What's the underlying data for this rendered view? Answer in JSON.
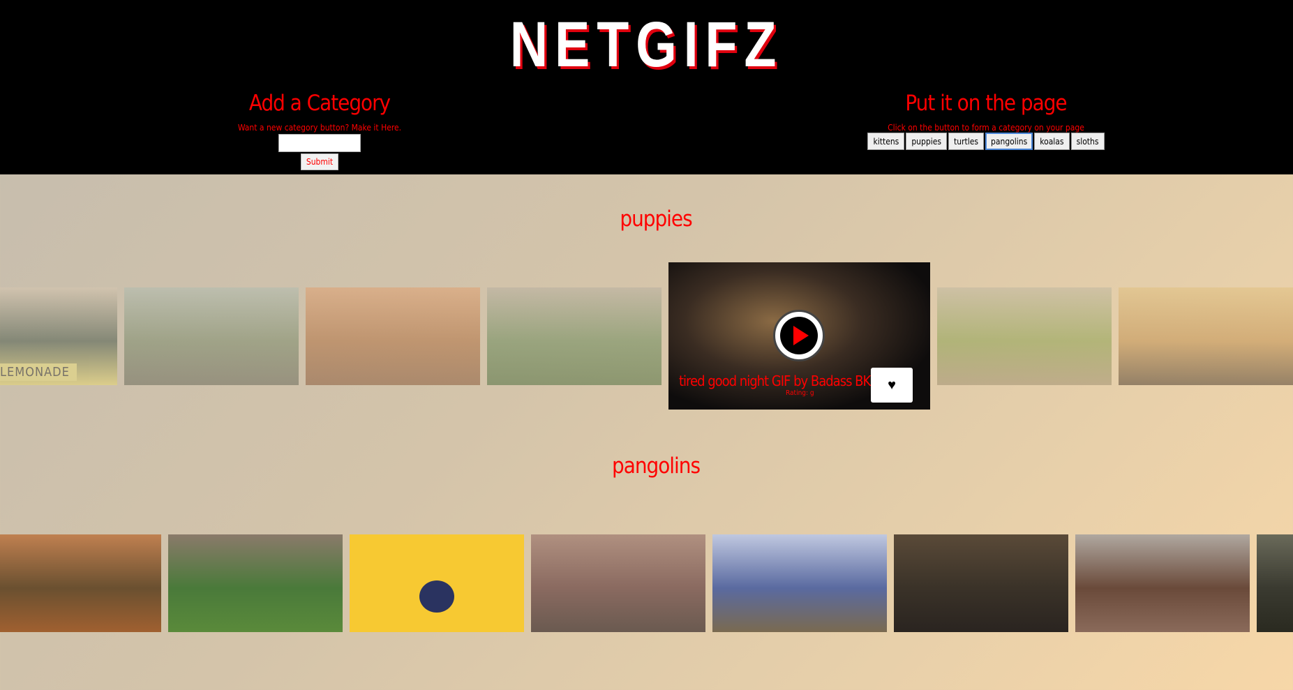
{
  "app": {
    "title": "NETGIFZ"
  },
  "add_category": {
    "heading": "Add a Category",
    "hint": "Want a new category button? Make it Here.",
    "input_value": "",
    "submit_label": "Submit"
  },
  "put_on_page": {
    "heading": "Put it on the page",
    "hint": "Click on the button to form a category on your page",
    "buttons": [
      "kittens",
      "puppies",
      "turtles",
      "pangolins",
      "koalas",
      "sloths"
    ],
    "focused_button": "pangolins"
  },
  "sections": [
    {
      "title": "puppies",
      "featured": {
        "title": "tired good night GIF by Badass BK",
        "rating": "Rating: g",
        "play_icon": "play-icon",
        "favorite_icon": "heart-icon"
      },
      "thumbs": [
        {
          "label": "LEMONADE",
          "colors": [
            "#4a5a4a",
            "#d6c6b0",
            "#e8d870"
          ]
        },
        {
          "colors": [
            "#7a8a6a",
            "#b0bcb0",
            "#6a6a5a"
          ]
        },
        {
          "colors": [
            "#b07040",
            "#e0a070",
            "#8a5a3a"
          ]
        },
        {
          "colors": [
            "#6a8a5a",
            "#b8b0a0",
            "#507040"
          ]
        },
        {
          "colors": [
            "#8aa050",
            "#c0b8a0",
            "#a09070"
          ]
        },
        {
          "colors": [
            "#c09050",
            "#e0c080",
            "#504030"
          ]
        }
      ]
    },
    {
      "title": "pangolins",
      "thumbs": [
        {
          "colors": [
            "#6a5030",
            "#c08050",
            "#a06030"
          ]
        },
        {
          "colors": [
            "#4a7a3a",
            "#8a7a6a",
            "#5a8a3a"
          ]
        },
        {
          "colors": [
            "#f7c932",
            "#f7c932",
            "#2a3360"
          ]
        },
        {
          "colors": [
            "#8a6a60",
            "#b09080",
            "#6a5a50"
          ]
        },
        {
          "colors": [
            "#5a6aa0",
            "#c0c8e0",
            "#7a6a50"
          ]
        },
        {
          "colors": [
            "#3a3228",
            "#5a4a38",
            "#2a2420"
          ]
        },
        {
          "colors": [
            "#6a4a3a",
            "#b0a8a0",
            "#8a6a5a"
          ]
        },
        {
          "colors": [
            "#3a3a30",
            "#6a6a5a",
            "#2a2a20"
          ]
        }
      ]
    }
  ]
}
